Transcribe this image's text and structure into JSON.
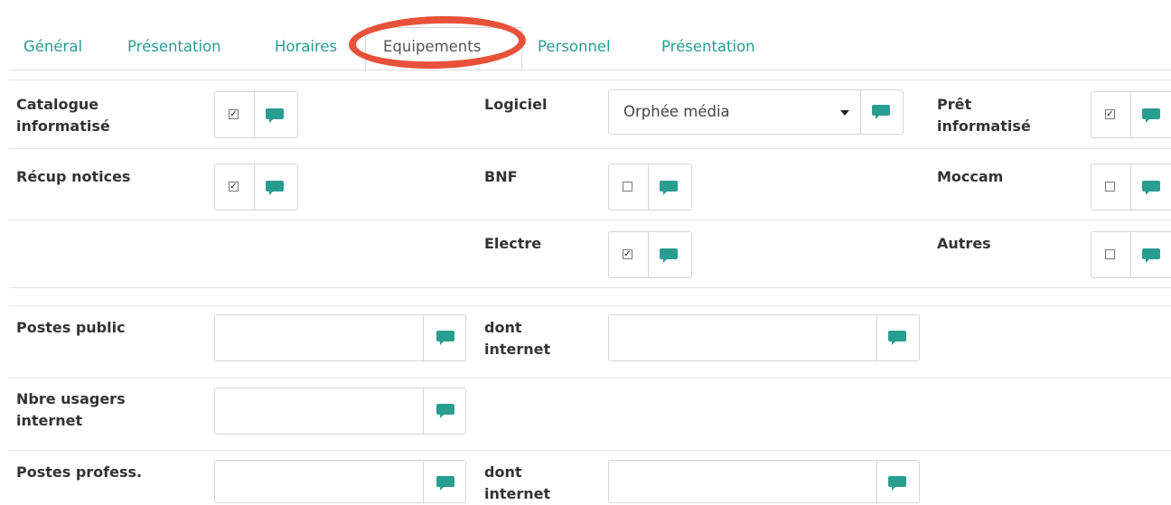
{
  "tabs": [
    {
      "label": "Général"
    },
    {
      "label": "Présentation"
    },
    {
      "label": "Horaires"
    },
    {
      "label": "Equipements"
    },
    {
      "label": "Personnel"
    },
    {
      "label": "Présentation"
    }
  ],
  "active_tab": "Equipements",
  "colors": {
    "accent": "#2a9d91",
    "annotation": "#e8513a"
  },
  "equipment": {
    "catalogue": {
      "label": "Catalogue informatisé",
      "checked": true
    },
    "logiciel": {
      "label": "Logiciel",
      "selected": "Orphée média"
    },
    "pret": {
      "label": "Prêt informatisé",
      "checked": true
    },
    "recup": {
      "label": "Récup notices",
      "checked": true
    },
    "bnf": {
      "label": "BNF",
      "checked": false
    },
    "moccam": {
      "label": "Moccam",
      "checked": false
    },
    "electre": {
      "label": "Electre",
      "checked": true
    },
    "autres": {
      "label": "Autres",
      "checked": false
    }
  },
  "postes": {
    "public": {
      "label": "Postes public",
      "value": ""
    },
    "public_internet": {
      "label": "dont internet",
      "value": ""
    },
    "usagers": {
      "label": "Nbre usagers internet",
      "value": ""
    },
    "profess": {
      "label": "Postes profess.",
      "value": ""
    },
    "profess_internet": {
      "label": "dont internet",
      "value": ""
    }
  },
  "icons": {
    "comment": "comment-bubble-icon"
  }
}
